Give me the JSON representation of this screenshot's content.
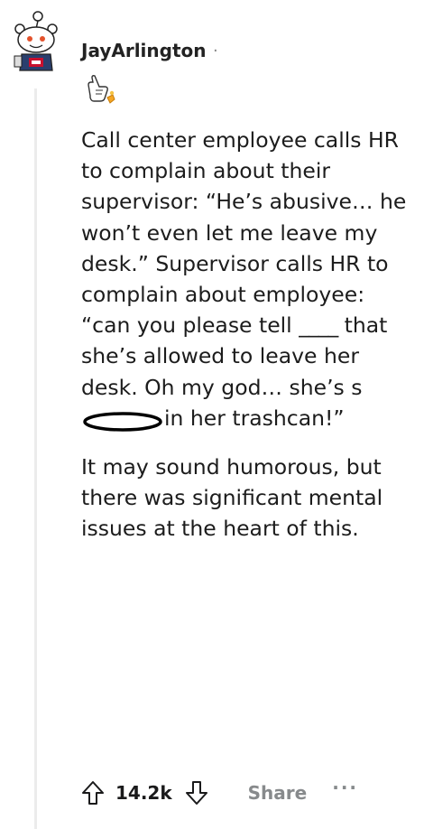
{
  "comment": {
    "author": "JayArlington",
    "separator": "·",
    "paragraphs": [
      {
        "parts": [
          "Call center employee calls HR to complain about their supervisor: “He’s abusive… he won’t even let me leave my desk.” Supervisor calls HR to complain about employee: “can you please tell ",
          "____",
          " that she’s allowed to leave her desk. Oh my god… she’s s",
          "in her trashcan!”"
        ]
      },
      {
        "text": "It may sound humorous, but there was significant mental issues at the heart of this."
      }
    ]
  },
  "actions": {
    "score": "14.2k",
    "share_label": "Share",
    "more_label": "···"
  },
  "icons": {
    "upvote": "arrow-up-icon",
    "downvote": "arrow-down-icon",
    "award": "hand-award-icon",
    "avatar": "snoo-avatar-icon",
    "censor": "censor-ellipse-icon"
  },
  "colors": {
    "text": "#1c1c1c",
    "muted": "#878a8c",
    "thread_line": "#ececec"
  }
}
